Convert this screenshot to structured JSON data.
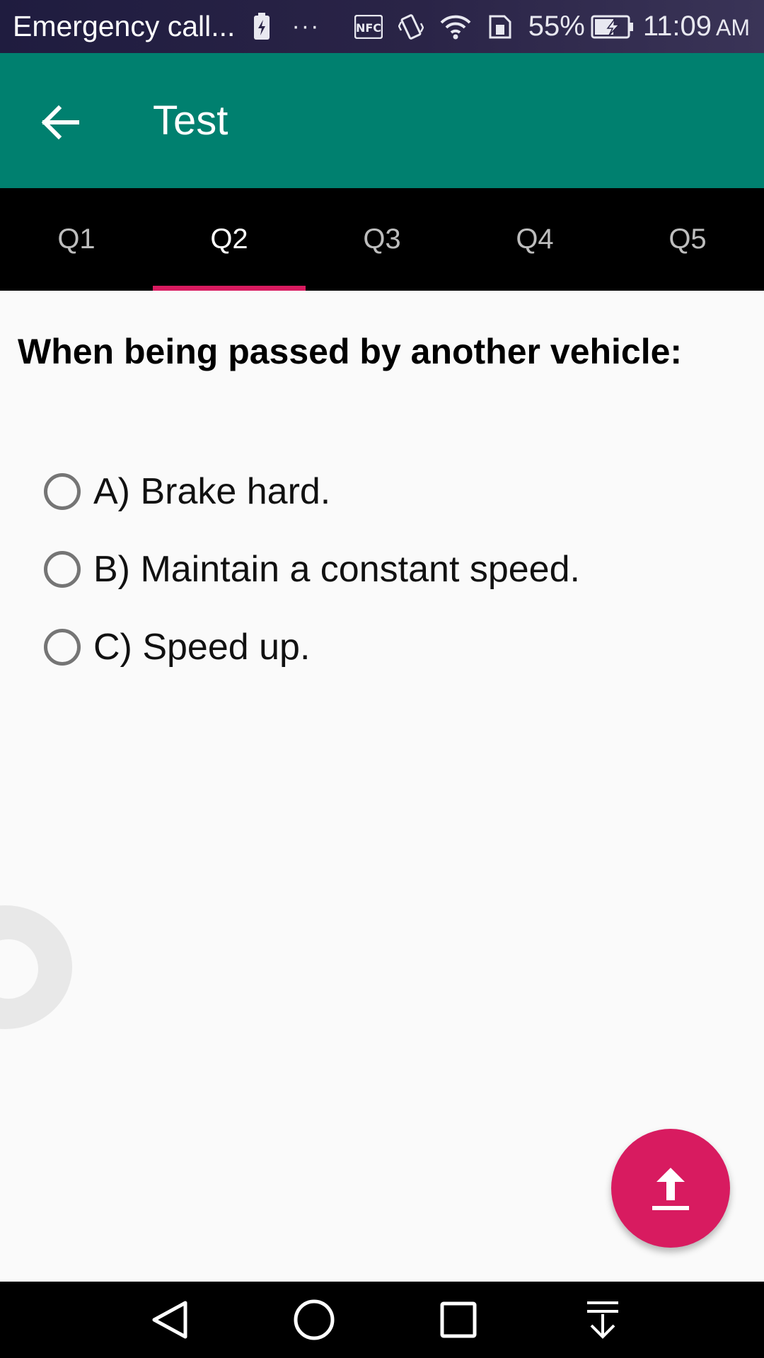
{
  "status_bar": {
    "carrier": "Emergency call...",
    "dots": "···",
    "nfc": "NFC",
    "battery_percent": "55%",
    "time": "11:09",
    "ampm": "AM",
    "icons": [
      "battery-saver-icon",
      "nfc-icon",
      "vibrate-icon",
      "wifi-icon",
      "sim-icon",
      "battery-charging-icon"
    ]
  },
  "app_bar": {
    "title": "Test",
    "back_icon": "arrow-back-icon",
    "background_color": "#00806f"
  },
  "tabs": [
    {
      "label": "Q1",
      "active": false
    },
    {
      "label": "Q2",
      "active": true
    },
    {
      "label": "Q3",
      "active": false
    },
    {
      "label": "Q4",
      "active": false
    },
    {
      "label": "Q5",
      "active": false
    }
  ],
  "tab_indicator_color": "#d81b60",
  "question": {
    "text": "When being passed by another vehicle:",
    "options": [
      {
        "label": "A) Brake hard.",
        "selected": false
      },
      {
        "label": "B) Maintain a constant speed.",
        "selected": false
      },
      {
        "label": "C) Speed up.",
        "selected": false
      }
    ]
  },
  "fab": {
    "icon": "upload-icon",
    "color": "#d81b60"
  },
  "nav_bar": {
    "buttons": [
      "back-triangle-icon",
      "home-circle-icon",
      "recents-square-icon",
      "notification-pulldown-icon"
    ]
  }
}
